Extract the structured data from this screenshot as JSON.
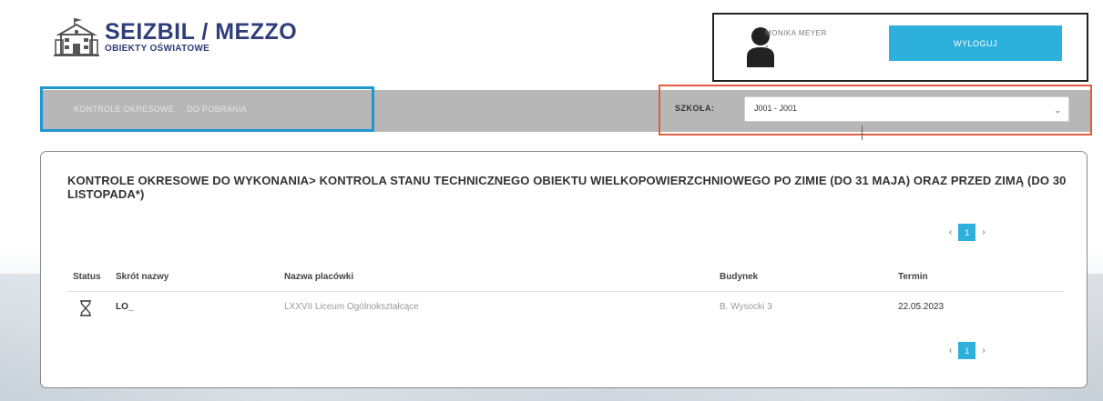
{
  "header": {
    "logo_title": "SEIZBIL / MEZZO",
    "logo_subtitle": "OBIEKTY OŚWIATOWE"
  },
  "user": {
    "name": "MONIKA MEYER",
    "sub": "-",
    "logout_label": "WYLOGUJ"
  },
  "nav": {
    "links": [
      "KONTROLE OKRESOWE",
      "DO POBRANIA"
    ]
  },
  "school": {
    "label": "SZKOŁA:",
    "selected": "J001 - J001"
  },
  "main": {
    "title": "KONTROLE OKRESOWE DO WYKONANIA> KONTROLA STANU TECHNICZNEGO OBIEKTU WIELKOPOWIERZCHNIOWEGO PO ZIMIE (DO 31 MAJA) ORAZ PRZED ZIMĄ (DO 30 LISTOPADA*)",
    "pagination": {
      "prev": "‹",
      "current": "1",
      "next": "›"
    },
    "table": {
      "headers": [
        "Status",
        "Skrót nazwy",
        "Nazwa placówki",
        "Budynek",
        "Termin"
      ],
      "rows": [
        {
          "status_icon": "hourglass-icon",
          "short_name": "LO_",
          "institution": "LXXVII Liceum Ogólnokształcące",
          "building": "B. Wysocki 3",
          "deadline": "22.05.2023"
        }
      ]
    }
  },
  "colors": {
    "accent": "#2eb0dd",
    "brand": "#2f3d7a",
    "nav_bg": "#b7b7b7",
    "highlight_blue": "#1e96d0",
    "highlight_red": "#e35b3c"
  }
}
